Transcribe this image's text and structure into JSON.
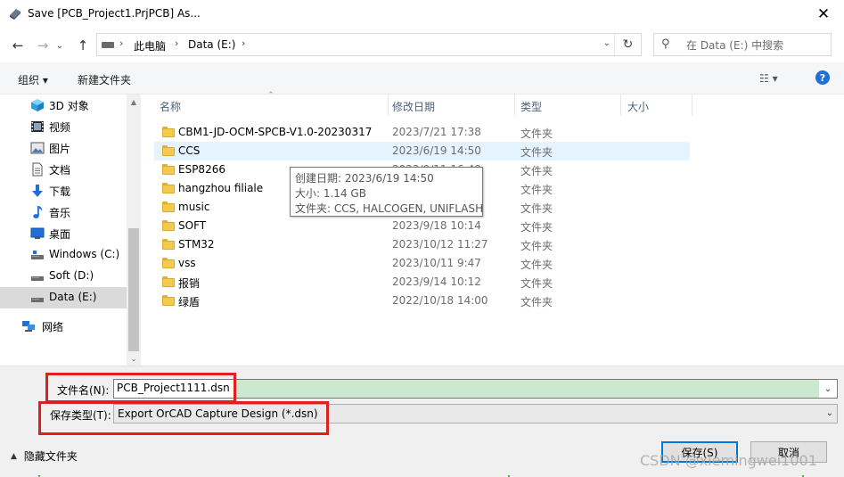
{
  "window": {
    "title": "Save [PCB_Project1.PrjPCB] As...",
    "close_glyph": "✕"
  },
  "nav": {
    "back_glyph": "←",
    "forward_glyph": "→",
    "recent_glyph": "⌄",
    "up_glyph": "↑",
    "breadcrumb": [
      "此电脑",
      "Data (E:)"
    ],
    "breadcrumb_sep": "›",
    "dropdown_glyph": "⌄",
    "refresh_glyph": "↻",
    "search_placeholder": "在 Data (E:) 中搜索",
    "search_glyph": "⚲"
  },
  "toolbar": {
    "organize_label": "组织 ▾",
    "new_folder_label": "新建文件夹",
    "view_glyph": "☷ ▾",
    "help_label": "?"
  },
  "sidebar": {
    "items": [
      {
        "label": "3D 对象",
        "icon": "cube-icon",
        "selected": false
      },
      {
        "label": "视频",
        "icon": "film-icon",
        "selected": false
      },
      {
        "label": "图片",
        "icon": "picture-icon",
        "selected": false
      },
      {
        "label": "文档",
        "icon": "document-icon",
        "selected": false
      },
      {
        "label": "下载",
        "icon": "download-icon",
        "selected": false
      },
      {
        "label": "音乐",
        "icon": "music-note-icon",
        "selected": false
      },
      {
        "label": "桌面",
        "icon": "desktop-icon",
        "selected": false
      },
      {
        "label": "Windows (C:)",
        "icon": "drive-icon",
        "selected": false
      },
      {
        "label": "Soft (D:)",
        "icon": "drive-icon",
        "selected": false
      },
      {
        "label": "Data (E:)",
        "icon": "drive-icon",
        "selected": true
      },
      {
        "label": "网络",
        "icon": "network-icon",
        "selected": false
      }
    ],
    "scroll_up_glyph": "▲",
    "scroll_down_glyph": "⌄"
  },
  "columns": {
    "name": "名称",
    "date": "修改日期",
    "type": "类型",
    "size": "大小",
    "sort_glyph": "⌃"
  },
  "files": [
    {
      "name": "CBM1-JD-OCM-SPCB-V1.0-20230317",
      "date": "2023/7/21 17:38",
      "type": "文件夹"
    },
    {
      "name": "CCS",
      "date": "2023/6/19 14:50",
      "type": "文件夹"
    },
    {
      "name": "ESP8266",
      "date": "2023/9/11 16:49",
      "type": "文件夹"
    },
    {
      "name": "hangzhou filiale",
      "date": "",
      "type": "文件夹"
    },
    {
      "name": "music",
      "date": "",
      "type": "文件夹"
    },
    {
      "name": "SOFT",
      "date": "2023/9/18 10:14",
      "type": "文件夹"
    },
    {
      "name": "STM32",
      "date": "2023/10/12 11:27",
      "type": "文件夹"
    },
    {
      "name": "vss",
      "date": "2023/10/11 9:47",
      "type": "文件夹"
    },
    {
      "name": "报销",
      "date": "2023/9/14 10:12",
      "type": "文件夹"
    },
    {
      "name": "绿盾",
      "date": "2022/10/18 14:00",
      "type": "文件夹"
    }
  ],
  "tooltip": {
    "created": "创建日期: 2023/6/19 14:50",
    "size": "大小: 1.14 GB",
    "contents": "文件夹: CCS, HALCOGEN, UNIFLASH"
  },
  "save": {
    "filename_label": "文件名(N):",
    "filename_value": "PCB_Project1111.dsn",
    "type_label": "保存类型(T):",
    "type_value": "Export OrCAD Capture Design (*.dsn)",
    "dropdown_glyph": "⌄",
    "hide_folders_caret": "▲",
    "hide_folders_label": "隐藏文件夹",
    "save_button": "保存(S)",
    "cancel_button": "取消"
  },
  "watermark": "CSDN @xiemingwei1001"
}
